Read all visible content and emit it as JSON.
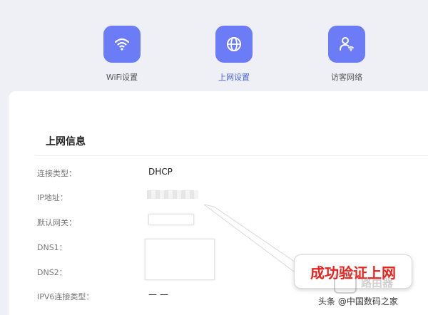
{
  "nav": {
    "items": [
      {
        "label": "WiFi设置",
        "icon": "wifi-icon",
        "active": false
      },
      {
        "label": "上网设置",
        "icon": "globe-icon",
        "active": true
      },
      {
        "label": "访客网络",
        "icon": "guest-user-icon",
        "active": false
      }
    ]
  },
  "colors": {
    "accent": "#6b7cf6",
    "active_text": "#4a63e8",
    "callout_text": "#e8231e"
  },
  "info": {
    "title": "上网信息",
    "rows": [
      {
        "label": "连接类型：",
        "value": "DHCP"
      },
      {
        "label": "IP地址：",
        "value": ""
      },
      {
        "label": "默认网关：",
        "value": ""
      },
      {
        "label": "DNS1：",
        "value": ""
      },
      {
        "label": "DNS2：",
        "value": ""
      },
      {
        "label": "IPV6连接类型：",
        "value": "— —"
      }
    ]
  },
  "callout": {
    "text": "成功验证上网"
  },
  "watermark": {
    "line1": "路由器",
    "line2": "头条 @中国数码之家"
  }
}
